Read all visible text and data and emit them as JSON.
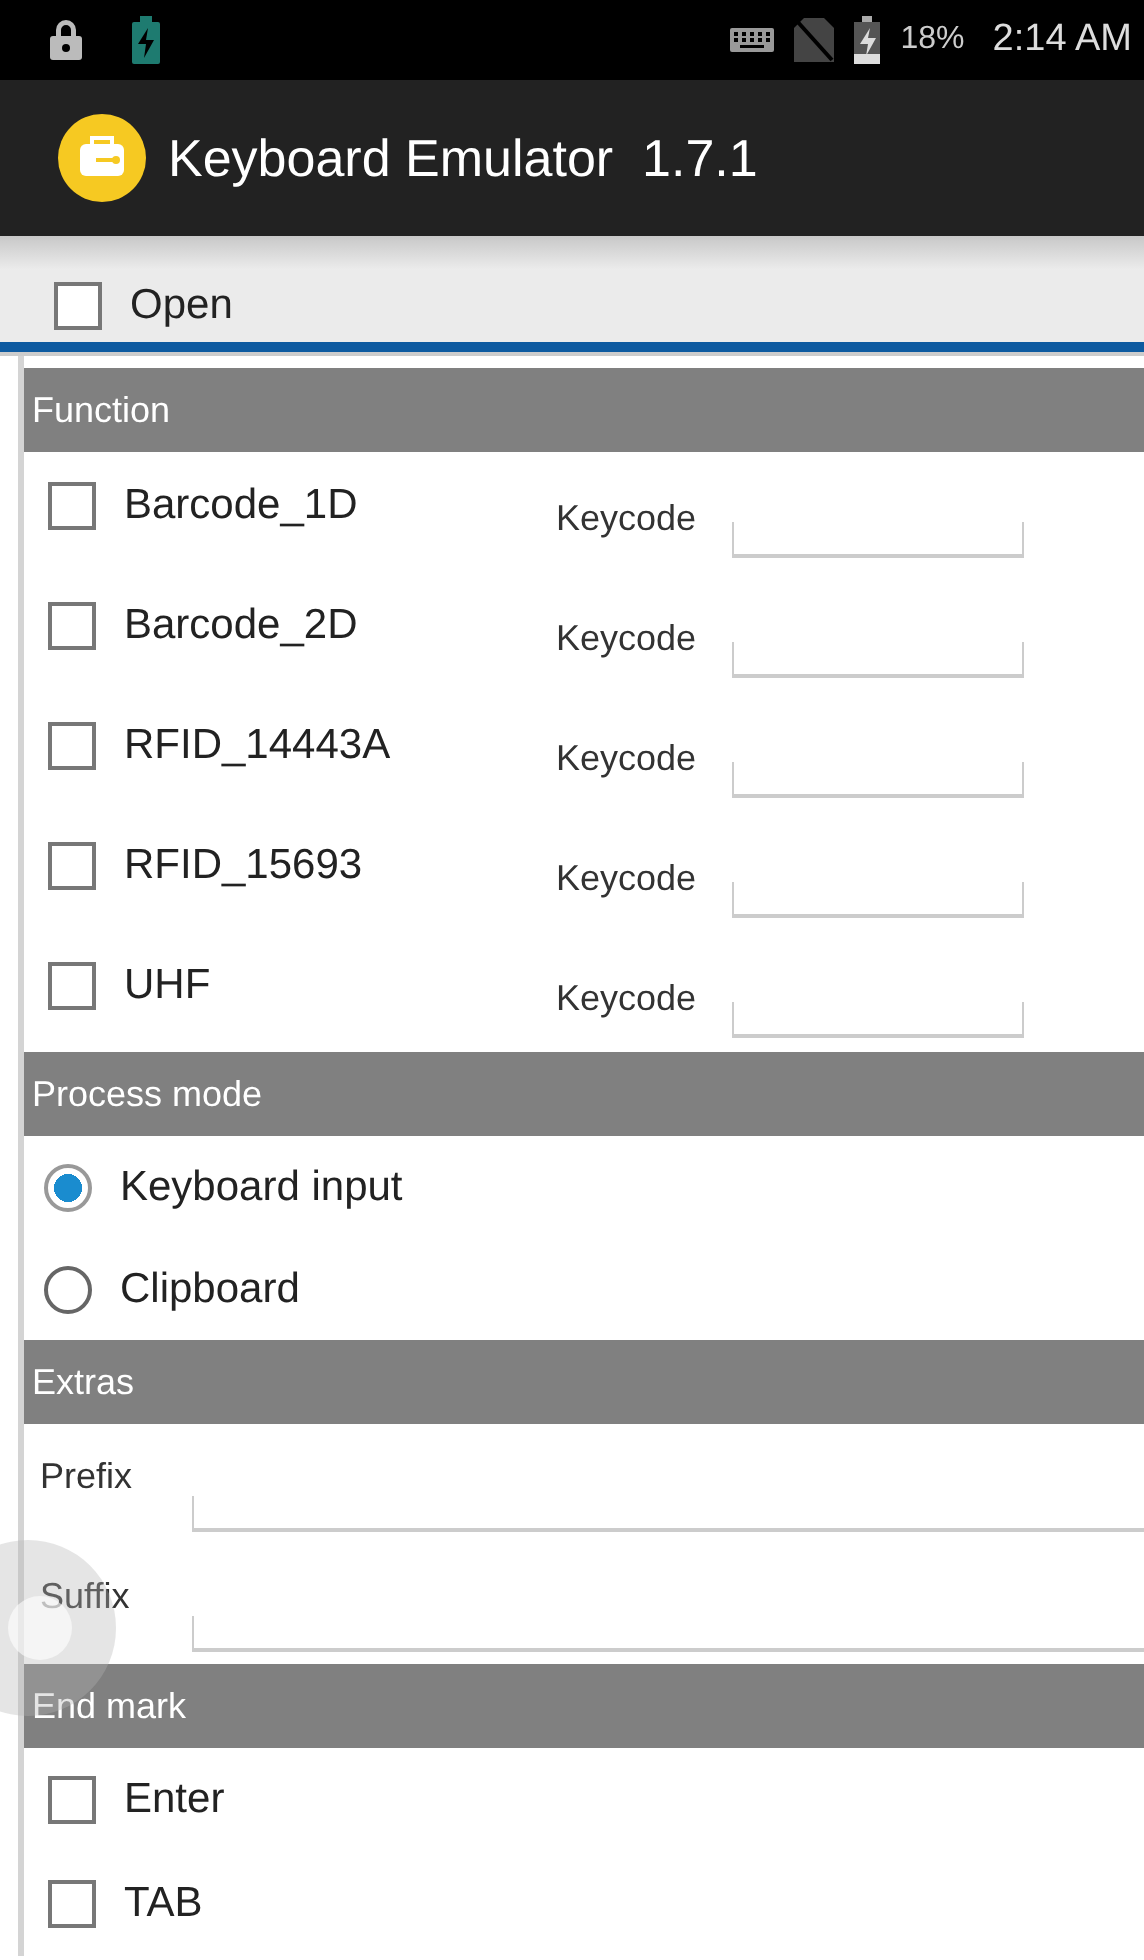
{
  "status_bar": {
    "battery": "18%",
    "time": "2:14 AM"
  },
  "app_bar": {
    "title": "Keyboard Emulator  1.7.1"
  },
  "open": {
    "label": "Open",
    "checked": false
  },
  "sections": [
    {
      "title": "Function",
      "kind": "functions",
      "items": [
        {
          "label": "Barcode_1D",
          "checked": false,
          "field_label": "Keycode"
        },
        {
          "label": "Barcode_2D",
          "checked": false,
          "field_label": "Keycode"
        },
        {
          "label": "RFID_14443A",
          "checked": false,
          "field_label": "Keycode"
        },
        {
          "label": "RFID_15693",
          "checked": false,
          "field_label": "Keycode"
        },
        {
          "label": "UHF",
          "checked": false,
          "field_label": "Keycode"
        }
      ]
    },
    {
      "title": "Process mode",
      "kind": "radios",
      "items": [
        {
          "label": "Keyboard input",
          "selected": true
        },
        {
          "label": "Clipboard",
          "selected": false
        }
      ]
    },
    {
      "title": "Extras",
      "kind": "fields",
      "items": [
        {
          "label": "Prefix"
        },
        {
          "label": "Suffix"
        }
      ]
    },
    {
      "title": "End mark",
      "kind": "checks",
      "items": [
        {
          "label": "Enter",
          "checked": false
        },
        {
          "label": "TAB",
          "checked": false
        }
      ]
    }
  ]
}
